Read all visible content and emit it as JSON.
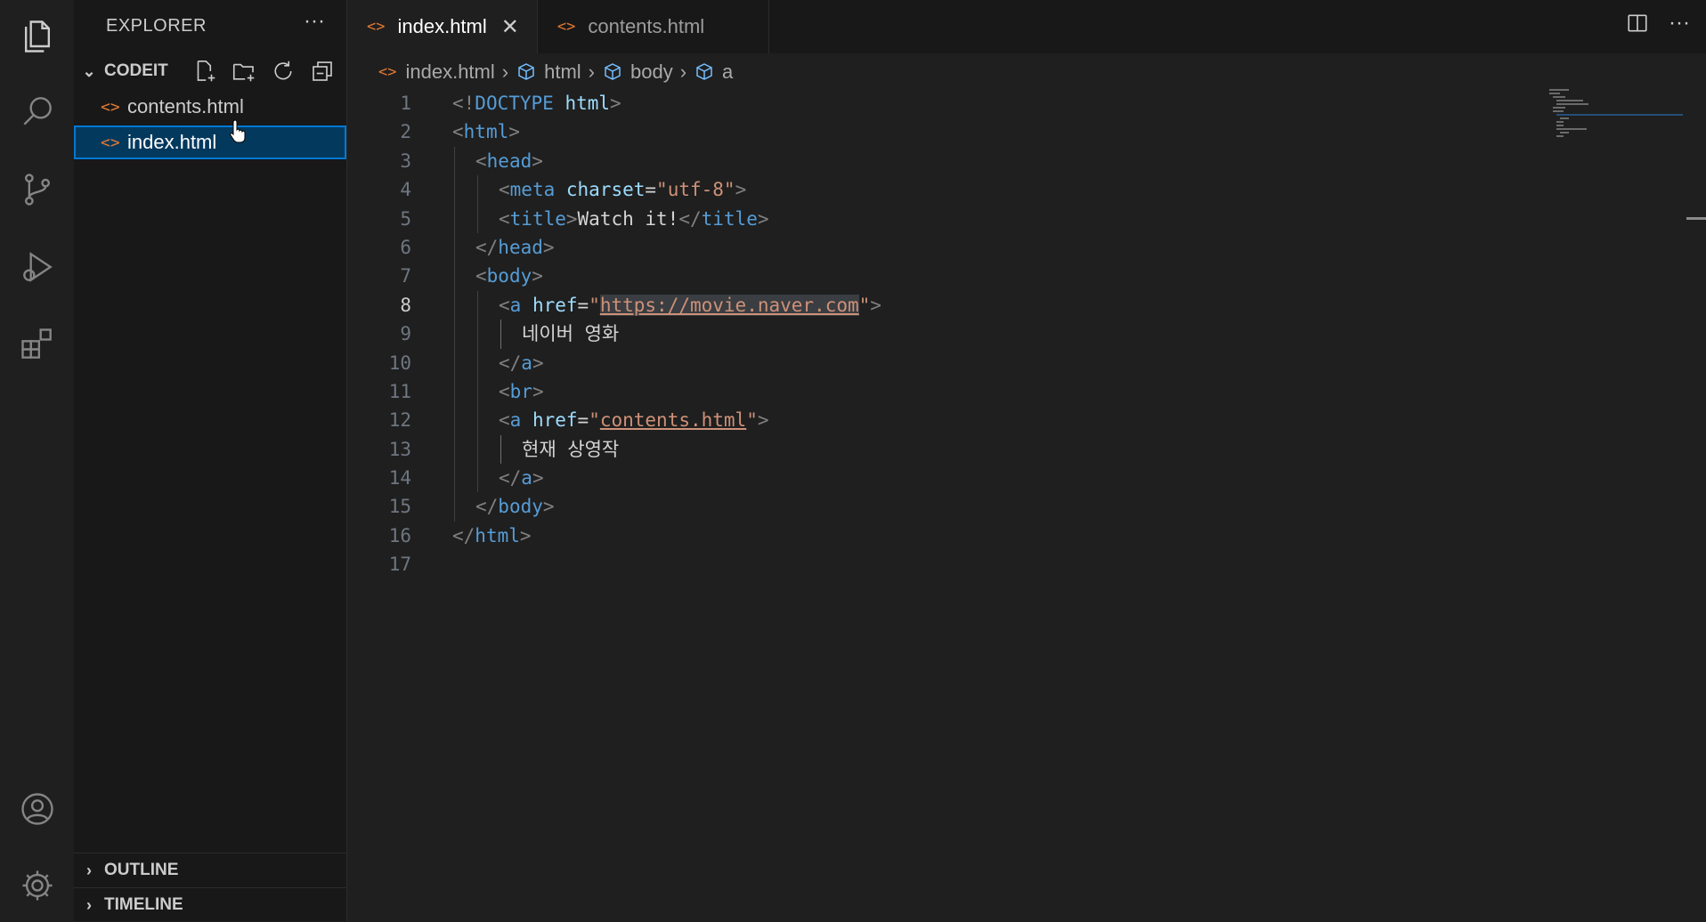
{
  "explorer": {
    "title": "EXPLORER",
    "more": "···",
    "folder_name": "CODEIT",
    "files": [
      {
        "name": "contents.html",
        "selected": false
      },
      {
        "name": "index.html",
        "selected": true
      }
    ],
    "outline_label": "OUTLINE",
    "timeline_label": "TIMELINE"
  },
  "tabs": [
    {
      "label": "index.html",
      "active": true,
      "close": "✕"
    },
    {
      "label": "contents.html",
      "active": false
    }
  ],
  "editor_more": "···",
  "breadcrumb": [
    "index.html",
    "html",
    "body",
    "a"
  ],
  "editor": {
    "current_line": 8,
    "lines": [
      {
        "n": "1",
        "indent": 0,
        "parts": [
          {
            "t": "<!",
            "c": "punct"
          },
          {
            "t": "DOCTYPE ",
            "c": "tag"
          },
          {
            "t": "html",
            "c": "attr"
          },
          {
            "t": ">",
            "c": "punct"
          }
        ]
      },
      {
        "n": "2",
        "indent": 0,
        "parts": [
          {
            "t": "<",
            "c": "punct"
          },
          {
            "t": "html",
            "c": "tag"
          },
          {
            "t": ">",
            "c": "punct"
          }
        ]
      },
      {
        "n": "3",
        "indent": 1,
        "parts": [
          {
            "t": "<",
            "c": "punct"
          },
          {
            "t": "head",
            "c": "tag"
          },
          {
            "t": ">",
            "c": "punct"
          }
        ]
      },
      {
        "n": "4",
        "indent": 2,
        "parts": [
          {
            "t": "<",
            "c": "punct"
          },
          {
            "t": "meta ",
            "c": "tag"
          },
          {
            "t": "charset",
            "c": "attr"
          },
          {
            "t": "=",
            "c": "plain"
          },
          {
            "t": "\"utf-8\"",
            "c": "str"
          },
          {
            "t": ">",
            "c": "punct"
          }
        ]
      },
      {
        "n": "5",
        "indent": 2,
        "parts": [
          {
            "t": "<",
            "c": "punct"
          },
          {
            "t": "title",
            "c": "tag"
          },
          {
            "t": ">",
            "c": "punct"
          },
          {
            "t": "Watch it!",
            "c": "plain"
          },
          {
            "t": "</",
            "c": "punct"
          },
          {
            "t": "title",
            "c": "tag"
          },
          {
            "t": ">",
            "c": "punct"
          }
        ]
      },
      {
        "n": "6",
        "indent": 1,
        "parts": [
          {
            "t": "</",
            "c": "punct"
          },
          {
            "t": "head",
            "c": "tag"
          },
          {
            "t": ">",
            "c": "punct"
          }
        ]
      },
      {
        "n": "7",
        "indent": 1,
        "parts": [
          {
            "t": "<",
            "c": "punct"
          },
          {
            "t": "body",
            "c": "tag"
          },
          {
            "t": ">",
            "c": "punct"
          }
        ]
      },
      {
        "n": "8",
        "indent": 2,
        "parts": [
          {
            "t": "<",
            "c": "punct"
          },
          {
            "t": "a ",
            "c": "tag"
          },
          {
            "t": "href",
            "c": "attr"
          },
          {
            "t": "=",
            "c": "plain"
          },
          {
            "t": "\"",
            "c": "str"
          },
          {
            "t": "https://movie.naver.com",
            "c": "str link hl"
          },
          {
            "t": "\"",
            "c": "str"
          },
          {
            "t": ">",
            "c": "punct"
          }
        ]
      },
      {
        "n": "9",
        "indent": 3,
        "parts": [
          {
            "t": "네이버 영화",
            "c": "plain"
          }
        ]
      },
      {
        "n": "10",
        "indent": 2,
        "parts": [
          {
            "t": "</",
            "c": "punct"
          },
          {
            "t": "a",
            "c": "tag"
          },
          {
            "t": ">",
            "c": "punct"
          }
        ]
      },
      {
        "n": "11",
        "indent": 2,
        "parts": [
          {
            "t": "<",
            "c": "punct"
          },
          {
            "t": "br",
            "c": "tag"
          },
          {
            "t": ">",
            "c": "punct"
          }
        ]
      },
      {
        "n": "12",
        "indent": 2,
        "parts": [
          {
            "t": "<",
            "c": "punct"
          },
          {
            "t": "a ",
            "c": "tag"
          },
          {
            "t": "href",
            "c": "attr"
          },
          {
            "t": "=",
            "c": "plain"
          },
          {
            "t": "\"",
            "c": "str"
          },
          {
            "t": "contents.html",
            "c": "str link"
          },
          {
            "t": "\"",
            "c": "str"
          },
          {
            "t": ">",
            "c": "punct"
          }
        ]
      },
      {
        "n": "13",
        "indent": 3,
        "parts": [
          {
            "t": "현재 상영작",
            "c": "plain"
          }
        ]
      },
      {
        "n": "14",
        "indent": 2,
        "parts": [
          {
            "t": "</",
            "c": "punct"
          },
          {
            "t": "a",
            "c": "tag"
          },
          {
            "t": ">",
            "c": "punct"
          }
        ]
      },
      {
        "n": "15",
        "indent": 1,
        "parts": [
          {
            "t": "</",
            "c": "punct"
          },
          {
            "t": "body",
            "c": "tag"
          },
          {
            "t": ">",
            "c": "punct"
          }
        ]
      },
      {
        "n": "16",
        "indent": 0,
        "parts": [
          {
            "t": "</",
            "c": "punct"
          },
          {
            "t": "html",
            "c": "tag"
          },
          {
            "t": ">",
            "c": "punct"
          }
        ]
      },
      {
        "n": "17",
        "indent": 0,
        "parts": []
      }
    ]
  },
  "colors": {
    "file_icon": "#e37933",
    "selection_border": "#0078d4",
    "selection_bg": "#04395e",
    "tag": "#569cd6",
    "attribute": "#9cdcfe",
    "string": "#ce9178"
  },
  "icons": {
    "activity_bar": [
      "files-icon",
      "search-icon",
      "source-control-icon",
      "run-debug-icon",
      "extensions-icon",
      "account-icon",
      "settings-gear-icon"
    ]
  }
}
